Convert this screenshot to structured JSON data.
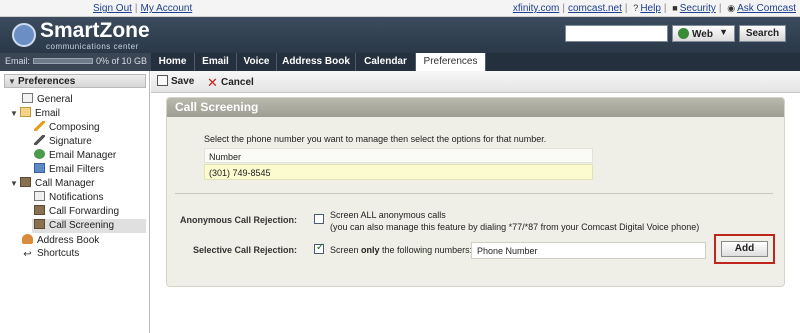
{
  "topbar": {
    "left_links": [
      "Sign Out",
      "My Account"
    ],
    "right_links": [
      "xfinity.com",
      "comcast.net",
      "Help",
      "Security",
      "Ask Comcast"
    ]
  },
  "header": {
    "logo_text": "SmartZone",
    "logo_sub": "communications center",
    "search_placeholder": "",
    "search_scope": "Web",
    "search_button": "Search"
  },
  "storage": {
    "label": "Email:",
    "usage": "0% of 10 GB",
    "used_fraction": 0
  },
  "tabs": [
    {
      "label": "Home"
    },
    {
      "label": "Email"
    },
    {
      "label": "Voice"
    },
    {
      "label": "Address Book"
    },
    {
      "label": "Calendar"
    },
    {
      "label": "Preferences",
      "active": true
    }
  ],
  "sidebar": {
    "header": "Preferences",
    "items": [
      {
        "label": "General",
        "icon": "general-icon"
      },
      {
        "label": "Email",
        "icon": "mail-icon"
      },
      {
        "label": "Composing",
        "icon": "pencil-icon"
      },
      {
        "label": "Signature",
        "icon": "signature-icon"
      },
      {
        "label": "Email Manager",
        "icon": "email-manager-icon"
      },
      {
        "label": "Email Filters",
        "icon": "filter-icon"
      },
      {
        "label": "Call Manager",
        "icon": "book-icon"
      },
      {
        "label": "Notifications",
        "icon": "notifications-icon"
      },
      {
        "label": "Call Forwarding",
        "icon": "call-forwarding-icon"
      },
      {
        "label": "Call Screening",
        "icon": "call-screening-icon",
        "selected": true
      },
      {
        "label": "Address Book",
        "icon": "address-book-icon"
      },
      {
        "label": "Shortcuts",
        "icon": "shortcuts-icon"
      }
    ]
  },
  "toolbar": {
    "save_label": "Save",
    "cancel_label": "Cancel"
  },
  "panel": {
    "title": "Call Screening",
    "intro": "Select the phone number you want to manage then select the options for that number.",
    "number_header": "Number",
    "number_value": "(301) 749-8545",
    "anonymous_label": "Anonymous Call Rejection:",
    "anonymous_option": "Screen ALL anonymous calls",
    "anonymous_note": "(you can also manage this feature by dialing *77/*87 from your Comcast Digital Voice phone)",
    "anonymous_checked": false,
    "selective_label": "Selective Call Rejection:",
    "selective_option_pre": "Screen ",
    "selective_option_bold": "only",
    "selective_option_post": " the following numbers:",
    "selective_checked": true,
    "phone_input_value": "Phone Number",
    "add_button": "Add"
  },
  "colors": {
    "header_bg": "#2f3d4d",
    "nav_bg": "#24303e",
    "panel_bg": "#efefe7",
    "panel_title_bg": "#a9a99d",
    "number_row_bg": "#fbfbcf",
    "highlight_border": "#c0241c",
    "link": "#1e3f8f"
  }
}
